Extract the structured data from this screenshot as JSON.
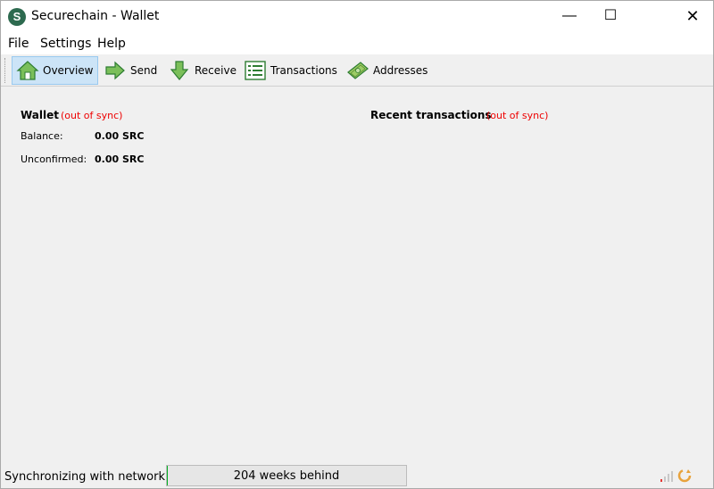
{
  "window": {
    "title": "Securechain - Wallet",
    "app_icon_letter": "S",
    "minimize": "—",
    "maximize": "☐",
    "close": "✕"
  },
  "menu": {
    "file": "File",
    "settings": "Settings",
    "help": "Help"
  },
  "toolbar": {
    "overview": "Overview",
    "send": "Send",
    "receive": "Receive",
    "transactions": "Transactions",
    "addresses": "Addresses",
    "active": "overview"
  },
  "wallet": {
    "title": "Wallet",
    "sync_warning": "(out of sync)",
    "balance_label": "Balance:",
    "balance_value": "0.00 SRC",
    "unconfirmed_label": "Unconfirmed:",
    "unconfirmed_value": "0.00 SRC"
  },
  "recent": {
    "title": "Recent transactions",
    "sync_warning": "(out of sync)"
  },
  "status": {
    "text": "Synchronizing with network...",
    "progress_text": "204 weeks behind",
    "progress_fraction": 0.002
  },
  "colors": {
    "accent_green": "#2d6a4f",
    "warning_red": "#e00000",
    "progress_green": "#06b025",
    "active_tab_bg": "#cce4f7"
  }
}
